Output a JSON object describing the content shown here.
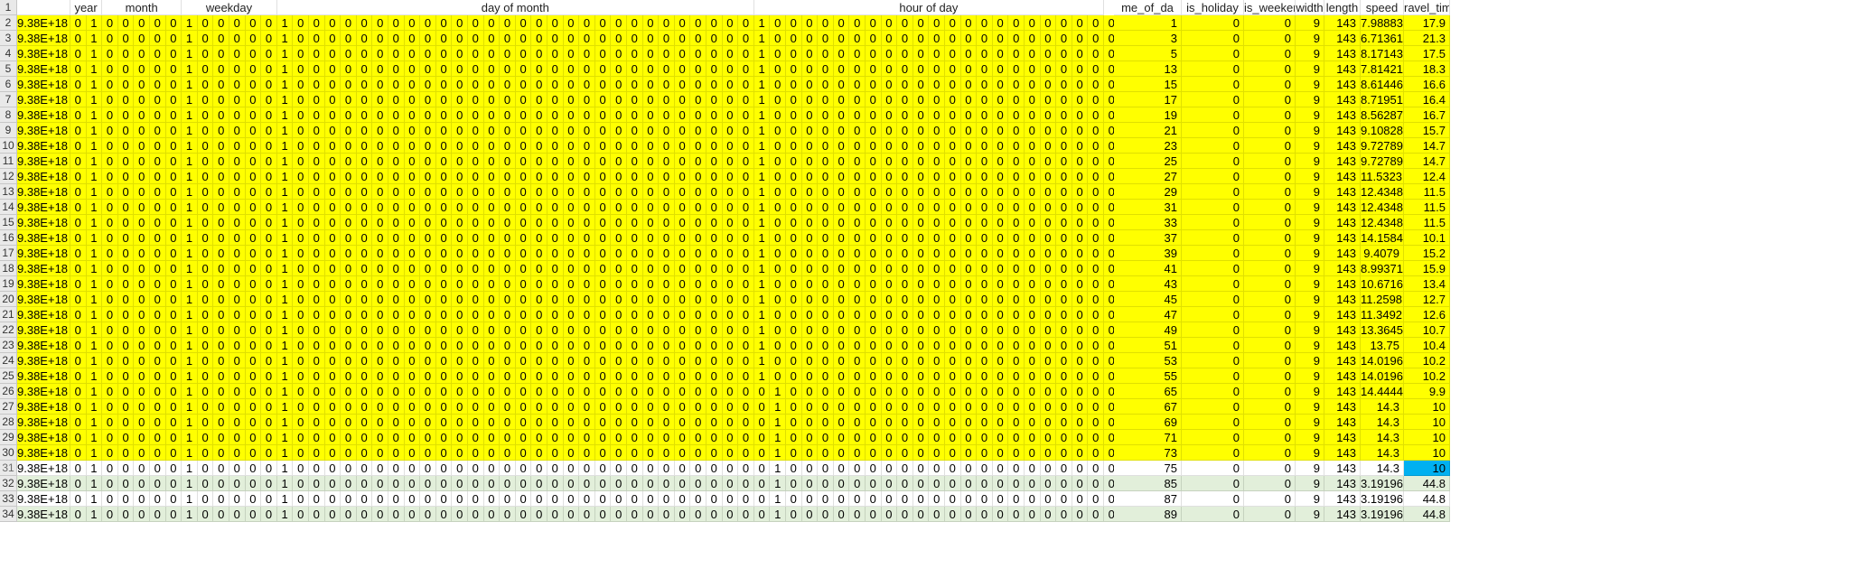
{
  "sheet": {
    "headers": {
      "col_b": "",
      "year": "year",
      "month": "month",
      "weekday": "weekday",
      "day_of_month": "day of month",
      "hour_of_day": "hour of day",
      "time_of_day": "me_of_da",
      "is_holiday": "is_holiday",
      "is_weekend": "is_weekend",
      "width": "width",
      "length": "length",
      "speed": "speed",
      "travel_time": "ravel_time"
    },
    "row_numbers": [
      "1",
      "2",
      "3",
      "4",
      "5",
      "6",
      "7",
      "8",
      "9",
      "10",
      "11",
      "12",
      "13",
      "14",
      "15",
      "16",
      "17",
      "18",
      "19",
      "20",
      "21",
      "22",
      "23",
      "24",
      "25",
      "26",
      "27",
      "28",
      "29",
      "30",
      "31",
      "32",
      "33",
      "34"
    ],
    "data_rows": [
      {
        "id": "9.38E+18",
        "one_hot": "0 1 0 0 0 0 0 1 0 0 0 0 0 1 0 0 0 0 0 0 0 0 0 0 0 0 0 0 0 0 0 0 0 0 0 0 0 0 0 0 0 0 0 1 0 0 0 0 0 0 0 0 0 0 0 0 0 0 0 0 0 0 0 0 0 0 0",
        "time_of_day": "1",
        "is_holiday": "0",
        "is_weekend": "0",
        "width": "9",
        "length": "143",
        "speed": "7.98883",
        "travel_time": "17.9",
        "style": "y"
      },
      {
        "id": "9.38E+18",
        "one_hot": "0 1 0 0 0 0 0 1 0 0 0 0 0 1 0 0 0 0 0 0 0 0 0 0 0 0 0 0 0 0 0 0 0 0 0 0 0 0 0 0 0 0 0 1 0 0 0 0 0 0 0 0 0 0 0 0 0 0 0 0 0 0 0 0 0 0 0",
        "time_of_day": "3",
        "is_holiday": "0",
        "is_weekend": "0",
        "width": "9",
        "length": "143",
        "speed": "6.71361",
        "travel_time": "21.3",
        "style": "y"
      },
      {
        "id": "9.38E+18",
        "one_hot": "0 1 0 0 0 0 0 1 0 0 0 0 0 1 0 0 0 0 0 0 0 0 0 0 0 0 0 0 0 0 0 0 0 0 0 0 0 0 0 0 0 0 0 1 0 0 0 0 0 0 0 0 0 0 0 0 0 0 0 0 0 0 0 0 0 0 0",
        "time_of_day": "5",
        "is_holiday": "0",
        "is_weekend": "0",
        "width": "9",
        "length": "143",
        "speed": "8.17143",
        "travel_time": "17.5",
        "style": "y"
      },
      {
        "id": "9.38E+18",
        "one_hot": "0 1 0 0 0 0 0 1 0 0 0 0 0 1 0 0 0 0 0 0 0 0 0 0 0 0 0 0 0 0 0 0 0 0 0 0 0 0 0 0 0 0 0 1 0 0 0 0 0 0 0 0 0 0 0 0 0 0 0 0 0 0 0 0 0 0 0",
        "time_of_day": "13",
        "is_holiday": "0",
        "is_weekend": "0",
        "width": "9",
        "length": "143",
        "speed": "7.81421",
        "travel_time": "18.3",
        "style": "y"
      },
      {
        "id": "9.38E+18",
        "one_hot": "0 1 0 0 0 0 0 1 0 0 0 0 0 1 0 0 0 0 0 0 0 0 0 0 0 0 0 0 0 0 0 0 0 0 0 0 0 0 0 0 0 0 0 1 0 0 0 0 0 0 0 0 0 0 0 0 0 0 0 0 0 0 0 0 0 0 0",
        "time_of_day": "15",
        "is_holiday": "0",
        "is_weekend": "0",
        "width": "9",
        "length": "143",
        "speed": "8.61446",
        "travel_time": "16.6",
        "style": "y"
      },
      {
        "id": "9.38E+18",
        "one_hot": "0 1 0 0 0 0 0 1 0 0 0 0 0 1 0 0 0 0 0 0 0 0 0 0 0 0 0 0 0 0 0 0 0 0 0 0 0 0 0 0 0 0 0 1 0 0 0 0 0 0 0 0 0 0 0 0 0 0 0 0 0 0 0 0 0 0 0",
        "time_of_day": "17",
        "is_holiday": "0",
        "is_weekend": "0",
        "width": "9",
        "length": "143",
        "speed": "8.71951",
        "travel_time": "16.4",
        "style": "y"
      },
      {
        "id": "9.38E+18",
        "one_hot": "0 1 0 0 0 0 0 1 0 0 0 0 0 1 0 0 0 0 0 0 0 0 0 0 0 0 0 0 0 0 0 0 0 0 0 0 0 0 0 0 0 0 0 1 0 0 0 0 0 0 0 0 0 0 0 0 0 0 0 0 0 0 0 0 0 0 0",
        "time_of_day": "19",
        "is_holiday": "0",
        "is_weekend": "0",
        "width": "9",
        "length": "143",
        "speed": "8.56287",
        "travel_time": "16.7",
        "style": "y"
      },
      {
        "id": "9.38E+18",
        "one_hot": "0 1 0 0 0 0 0 1 0 0 0 0 0 1 0 0 0 0 0 0 0 0 0 0 0 0 0 0 0 0 0 0 0 0 0 0 0 0 0 0 0 0 0 1 0 0 0 0 0 0 0 0 0 0 0 0 0 0 0 0 0 0 0 0 0 0 0",
        "time_of_day": "21",
        "is_holiday": "0",
        "is_weekend": "0",
        "width": "9",
        "length": "143",
        "speed": "9.10828",
        "travel_time": "15.7",
        "style": "y"
      },
      {
        "id": "9.38E+18",
        "one_hot": "0 1 0 0 0 0 0 1 0 0 0 0 0 1 0 0 0 0 0 0 0 0 0 0 0 0 0 0 0 0 0 0 0 0 0 0 0 0 0 0 0 0 0 1 0 0 0 0 0 0 0 0 0 0 0 0 0 0 0 0 0 0 0 0 0 0 0",
        "time_of_day": "23",
        "is_holiday": "0",
        "is_weekend": "0",
        "width": "9",
        "length": "143",
        "speed": "9.72789",
        "travel_time": "14.7",
        "style": "y"
      },
      {
        "id": "9.38E+18",
        "one_hot": "0 1 0 0 0 0 0 1 0 0 0 0 0 1 0 0 0 0 0 0 0 0 0 0 0 0 0 0 0 0 0 0 0 0 0 0 0 0 0 0 0 0 0 1 0 0 0 0 0 0 0 0 0 0 0 0 0 0 0 0 0 0 0 0 0 0 0",
        "time_of_day": "25",
        "is_holiday": "0",
        "is_weekend": "0",
        "width": "9",
        "length": "143",
        "speed": "9.72789",
        "travel_time": "14.7",
        "style": "y"
      },
      {
        "id": "9.38E+18",
        "one_hot": "0 1 0 0 0 0 0 1 0 0 0 0 0 1 0 0 0 0 0 0 0 0 0 0 0 0 0 0 0 0 0 0 0 0 0 0 0 0 0 0 0 0 0 1 0 0 0 0 0 0 0 0 0 0 0 0 0 0 0 0 0 0 0 0 0 0 0",
        "time_of_day": "27",
        "is_holiday": "0",
        "is_weekend": "0",
        "width": "9",
        "length": "143",
        "speed": "11.5323",
        "travel_time": "12.4",
        "style": "y"
      },
      {
        "id": "9.38E+18",
        "one_hot": "0 1 0 0 0 0 0 1 0 0 0 0 0 1 0 0 0 0 0 0 0 0 0 0 0 0 0 0 0 0 0 0 0 0 0 0 0 0 0 0 0 0 0 1 0 0 0 0 0 0 0 0 0 0 0 0 0 0 0 0 0 0 0 0 0 0 0",
        "time_of_day": "29",
        "is_holiday": "0",
        "is_weekend": "0",
        "width": "9",
        "length": "143",
        "speed": "12.4348",
        "travel_time": "11.5",
        "style": "y"
      },
      {
        "id": "9.38E+18",
        "one_hot": "0 1 0 0 0 0 0 1 0 0 0 0 0 1 0 0 0 0 0 0 0 0 0 0 0 0 0 0 0 0 0 0 0 0 0 0 0 0 0 0 0 0 0 1 0 0 0 0 0 0 0 0 0 0 0 0 0 0 0 0 0 0 0 0 0 0 0",
        "time_of_day": "31",
        "is_holiday": "0",
        "is_weekend": "0",
        "width": "9",
        "length": "143",
        "speed": "12.4348",
        "travel_time": "11.5",
        "style": "y"
      },
      {
        "id": "9.38E+18",
        "one_hot": "0 1 0 0 0 0 0 1 0 0 0 0 0 1 0 0 0 0 0 0 0 0 0 0 0 0 0 0 0 0 0 0 0 0 0 0 0 0 0 0 0 0 0 1 0 0 0 0 0 0 0 0 0 0 0 0 0 0 0 0 0 0 0 0 0 0 0",
        "time_of_day": "33",
        "is_holiday": "0",
        "is_weekend": "0",
        "width": "9",
        "length": "143",
        "speed": "12.4348",
        "travel_time": "11.5",
        "style": "y"
      },
      {
        "id": "9.38E+18",
        "one_hot": "0 1 0 0 0 0 0 1 0 0 0 0 0 1 0 0 0 0 0 0 0 0 0 0 0 0 0 0 0 0 0 0 0 0 0 0 0 0 0 0 0 0 0 1 0 0 0 0 0 0 0 0 0 0 0 0 0 0 0 0 0 0 0 0 0 0 0",
        "time_of_day": "37",
        "is_holiday": "0",
        "is_weekend": "0",
        "width": "9",
        "length": "143",
        "speed": "14.1584",
        "travel_time": "10.1",
        "style": "y"
      },
      {
        "id": "9.38E+18",
        "one_hot": "0 1 0 0 0 0 0 1 0 0 0 0 0 1 0 0 0 0 0 0 0 0 0 0 0 0 0 0 0 0 0 0 0 0 0 0 0 0 0 0 0 0 0 1 0 0 0 0 0 0 0 0 0 0 0 0 0 0 0 0 0 0 0 0 0 0 0",
        "time_of_day": "39",
        "is_holiday": "0",
        "is_weekend": "0",
        "width": "9",
        "length": "143",
        "speed": "9.4079",
        "travel_time": "15.2",
        "style": "y"
      },
      {
        "id": "9.38E+18",
        "one_hot": "0 1 0 0 0 0 0 1 0 0 0 0 0 1 0 0 0 0 0 0 0 0 0 0 0 0 0 0 0 0 0 0 0 0 0 0 0 0 0 0 0 0 0 1 0 0 0 0 0 0 0 0 0 0 0 0 0 0 0 0 0 0 0 0 0 0 0",
        "time_of_day": "41",
        "is_holiday": "0",
        "is_weekend": "0",
        "width": "9",
        "length": "143",
        "speed": "8.99371",
        "travel_time": "15.9",
        "style": "y"
      },
      {
        "id": "9.38E+18",
        "one_hot": "0 1 0 0 0 0 0 1 0 0 0 0 0 1 0 0 0 0 0 0 0 0 0 0 0 0 0 0 0 0 0 0 0 0 0 0 0 0 0 0 0 0 0 1 0 0 0 0 0 0 0 0 0 0 0 0 0 0 0 0 0 0 0 0 0 0 0",
        "time_of_day": "43",
        "is_holiday": "0",
        "is_weekend": "0",
        "width": "9",
        "length": "143",
        "speed": "10.6716",
        "travel_time": "13.4",
        "style": "y"
      },
      {
        "id": "9.38E+18",
        "one_hot": "0 1 0 0 0 0 0 1 0 0 0 0 0 1 0 0 0 0 0 0 0 0 0 0 0 0 0 0 0 0 0 0 0 0 0 0 0 0 0 0 0 0 0 1 0 0 0 0 0 0 0 0 0 0 0 0 0 0 0 0 0 0 0 0 0 0 0",
        "time_of_day": "45",
        "is_holiday": "0",
        "is_weekend": "0",
        "width": "9",
        "length": "143",
        "speed": "11.2598",
        "travel_time": "12.7",
        "style": "y"
      },
      {
        "id": "9.38E+18",
        "one_hot": "0 1 0 0 0 0 0 1 0 0 0 0 0 1 0 0 0 0 0 0 0 0 0 0 0 0 0 0 0 0 0 0 0 0 0 0 0 0 0 0 0 0 0 1 0 0 0 0 0 0 0 0 0 0 0 0 0 0 0 0 0 0 0 0 0 0 0",
        "time_of_day": "47",
        "is_holiday": "0",
        "is_weekend": "0",
        "width": "9",
        "length": "143",
        "speed": "11.3492",
        "travel_time": "12.6",
        "style": "y"
      },
      {
        "id": "9.38E+18",
        "one_hot": "0 1 0 0 0 0 0 1 0 0 0 0 0 1 0 0 0 0 0 0 0 0 0 0 0 0 0 0 0 0 0 0 0 0 0 0 0 0 0 0 0 0 0 1 0 0 0 0 0 0 0 0 0 0 0 0 0 0 0 0 0 0 0 0 0 0 0",
        "time_of_day": "49",
        "is_holiday": "0",
        "is_weekend": "0",
        "width": "9",
        "length": "143",
        "speed": "13.3645",
        "travel_time": "10.7",
        "style": "y"
      },
      {
        "id": "9.38E+18",
        "one_hot": "0 1 0 0 0 0 0 1 0 0 0 0 0 1 0 0 0 0 0 0 0 0 0 0 0 0 0 0 0 0 0 0 0 0 0 0 0 0 0 0 0 0 0 1 0 0 0 0 0 0 0 0 0 0 0 0 0 0 0 0 0 0 0 0 0 0 0",
        "time_of_day": "51",
        "is_holiday": "0",
        "is_weekend": "0",
        "width": "9",
        "length": "143",
        "speed": "13.75",
        "travel_time": "10.4",
        "style": "y"
      },
      {
        "id": "9.38E+18",
        "one_hot": "0 1 0 0 0 0 0 1 0 0 0 0 0 1 0 0 0 0 0 0 0 0 0 0 0 0 0 0 0 0 0 0 0 0 0 0 0 0 0 0 0 0 0 1 0 0 0 0 0 0 0 0 0 0 0 0 0 0 0 0 0 0 0 0 0 0 0",
        "time_of_day": "53",
        "is_holiday": "0",
        "is_weekend": "0",
        "width": "9",
        "length": "143",
        "speed": "14.0196",
        "travel_time": "10.2",
        "style": "y"
      },
      {
        "id": "9.38E+18",
        "one_hot": "0 1 0 0 0 0 0 1 0 0 0 0 0 1 0 0 0 0 0 0 0 0 0 0 0 0 0 0 0 0 0 0 0 0 0 0 0 0 0 0 0 0 0 1 0 0 0 0 0 0 0 0 0 0 0 0 0 0 0 0 0 0 0 0 0 0 0",
        "time_of_day": "55",
        "is_holiday": "0",
        "is_weekend": "0",
        "width": "9",
        "length": "143",
        "speed": "14.0196",
        "travel_time": "10.2",
        "style": "y"
      },
      {
        "id": "9.38E+18",
        "one_hot": "0 1 0 0 0 0 0 1 0 0 0 0 0 1 0 0 0 0 0 0 0 0 0 0 0 0 0 0 0 0 0 0 0 0 0 0 0 0 0 0 0 0 0 0 1 0 0 0 0 0 0 0 0 0 0 0 0 0 0 0 0 0 0 0 0 0 0",
        "time_of_day": "65",
        "is_holiday": "0",
        "is_weekend": "0",
        "width": "9",
        "length": "143",
        "speed": "14.4444",
        "travel_time": "9.9",
        "style": "y"
      },
      {
        "id": "9.38E+18",
        "one_hot": "0 1 0 0 0 0 0 1 0 0 0 0 0 1 0 0 0 0 0 0 0 0 0 0 0 0 0 0 0 0 0 0 0 0 0 0 0 0 0 0 0 0 0 0 1 0 0 0 0 0 0 0 0 0 0 0 0 0 0 0 0 0 0 0 0 0 0",
        "time_of_day": "67",
        "is_holiday": "0",
        "is_weekend": "0",
        "width": "9",
        "length": "143",
        "speed": "14.3",
        "travel_time": "10",
        "style": "y"
      },
      {
        "id": "9.38E+18",
        "one_hot": "0 1 0 0 0 0 0 1 0 0 0 0 0 1 0 0 0 0 0 0 0 0 0 0 0 0 0 0 0 0 0 0 0 0 0 0 0 0 0 0 0 0 0 0 1 0 0 0 0 0 0 0 0 0 0 0 0 0 0 0 0 0 0 0 0 0 0",
        "time_of_day": "69",
        "is_holiday": "0",
        "is_weekend": "0",
        "width": "9",
        "length": "143",
        "speed": "14.3",
        "travel_time": "10",
        "style": "y"
      },
      {
        "id": "9.38E+18",
        "one_hot": "0 1 0 0 0 0 0 1 0 0 0 0 0 1 0 0 0 0 0 0 0 0 0 0 0 0 0 0 0 0 0 0 0 0 0 0 0 0 0 0 0 0 0 0 1 0 0 0 0 0 0 0 0 0 0 0 0 0 0 0 0 0 0 0 0 0 0",
        "time_of_day": "71",
        "is_holiday": "0",
        "is_weekend": "0",
        "width": "9",
        "length": "143",
        "speed": "14.3",
        "travel_time": "10",
        "style": "y"
      },
      {
        "id": "9.38E+18",
        "one_hot": "0 1 0 0 0 0 0 1 0 0 0 0 0 1 0 0 0 0 0 0 0 0 0 0 0 0 0 0 0 0 0 0 0 0 0 0 0 0 0 0 0 0 0 0 1 0 0 0 0 0 0 0 0 0 0 0 0 0 0 0 0 0 0 0 0 0 0",
        "time_of_day": "73",
        "is_holiday": "0",
        "is_weekend": "0",
        "width": "9",
        "length": "143",
        "speed": "14.3",
        "travel_time": "10",
        "style": "y"
      },
      {
        "id": "9.38E+18",
        "one_hot": "0 1 0 0 0 0 0 1 0 0 0 0 0 1 0 0 0 0 0 0 0 0 0 0 0 0 0 0 0 0 0 0 0 0 0 0 0 0 0 0 0 0 0 0 1 0 0 0 0 0 0 0 0 0 0 0 0 0 0 0 0 0 0 0 0 0 0",
        "time_of_day": "75",
        "is_holiday": "0",
        "is_weekend": "0",
        "width": "9",
        "length": "143",
        "speed": "14.3",
        "travel_time": "10",
        "style": "w",
        "selected_travel_time": true
      },
      {
        "id": "9.38E+18",
        "one_hot": "0 1 0 0 0 0 0 1 0 0 0 0 0 1 0 0 0 0 0 0 0 0 0 0 0 0 0 0 0 0 0 0 0 0 0 0 0 0 0 0 0 0 0 0 1 0 0 0 0 0 0 0 0 0 0 0 0 0 0 0 0 0 0 0 0 0 0",
        "time_of_day": "85",
        "is_holiday": "0",
        "is_weekend": "0",
        "width": "9",
        "length": "143",
        "speed": "3.19196",
        "travel_time": "44.8",
        "style": "g"
      },
      {
        "id": "9.38E+18",
        "one_hot": "0 1 0 0 0 0 0 1 0 0 0 0 0 1 0 0 0 0 0 0 0 0 0 0 0 0 0 0 0 0 0 0 0 0 0 0 0 0 0 0 0 0 0 0 1 0 0 0 0 0 0 0 0 0 0 0 0 0 0 0 0 0 0 0 0 0 0",
        "time_of_day": "87",
        "is_holiday": "0",
        "is_weekend": "0",
        "width": "9",
        "length": "143",
        "speed": "3.19196",
        "travel_time": "44.8",
        "style": "w"
      },
      {
        "id": "9.38E+18",
        "one_hot": "0 1 0 0 0 0 0 1 0 0 0 0 0 1 0 0 0 0 0 0 0 0 0 0 0 0 0 0 0 0 0 0 0 0 0 0 0 0 0 0 0 0 0 0 1 0 0 0 0 0 0 0 0 0 0 0 0 0 0 0 0 0 0 0 0 0 0",
        "time_of_day": "89",
        "is_holiday": "0",
        "is_weekend": "0",
        "width": "9",
        "length": "143",
        "speed": "3.19196",
        "travel_time": "44.8",
        "style": "g"
      }
    ],
    "colors": {
      "highlight_yellow": "#ffff00",
      "band_green": "#e2efda",
      "selected_cell": "#00b0f0",
      "row_header": "#e9e9e9"
    }
  }
}
